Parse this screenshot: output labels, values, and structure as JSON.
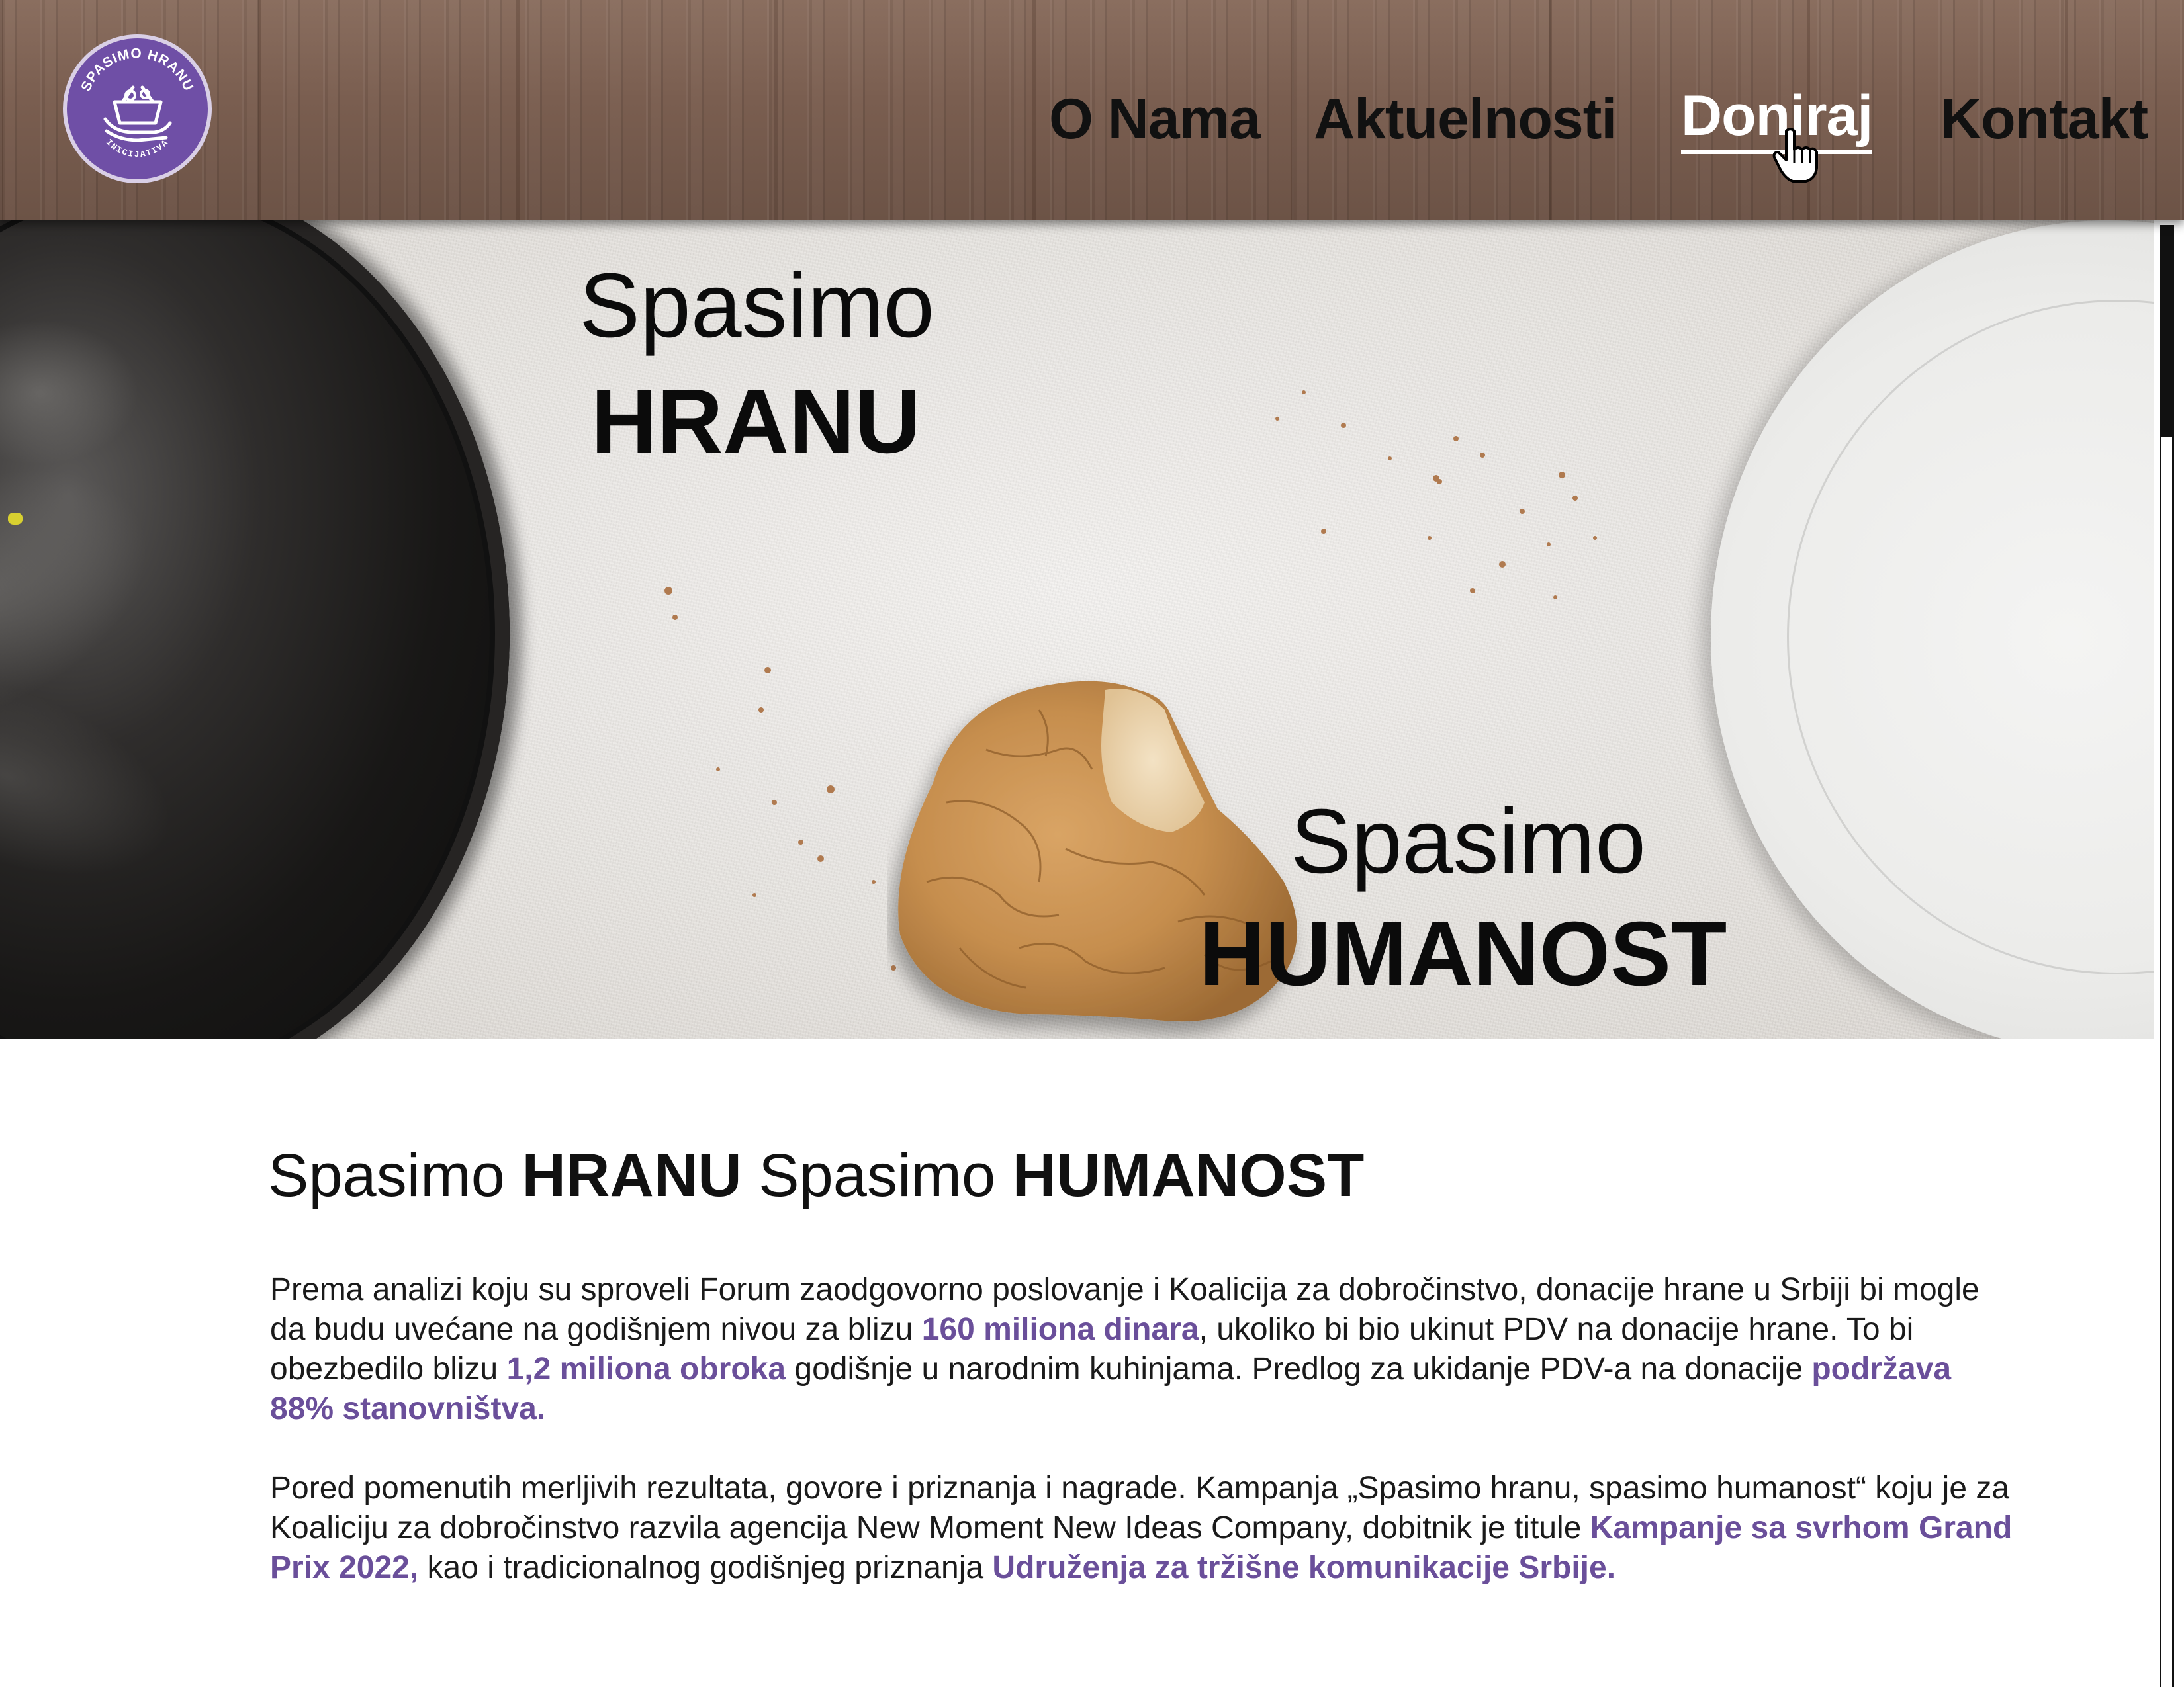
{
  "brand": {
    "logo_top_text": "SPASIMO HRANU",
    "logo_bottom_text": "INICIJATIVA",
    "accent_color": "#6f4fa6"
  },
  "nav": {
    "items": [
      {
        "label": "O Nama"
      },
      {
        "label": "Aktuelnosti"
      },
      {
        "label": "Doniraj",
        "active": true
      },
      {
        "label": "Kontakt"
      }
    ]
  },
  "hero": {
    "line1_light": "Spasimo",
    "line1_bold": "HRANU",
    "line2_light": "Spasimo",
    "line2_bold": "HUMANOST"
  },
  "content": {
    "title": {
      "part1": "Spasimo ",
      "part2": "HRANU",
      "part3": " Spasimo ",
      "part4": "HUMANOST"
    },
    "paragraph1": {
      "t1": "Prema analizi koju su sproveli Forum zaodgovorno poslovanje i Koalicija za dobročinstvo, donacije hrane u Srbiji bi mogle da budu uvećane na godišnjem nivou za blizu ",
      "h1": "160 miliona dinara",
      "t2": ", ukoliko bi bio ukinut PDV na donacije hrane.  To bi obezbedilo blizu ",
      "h2": "1,2 miliona obroka",
      "t3": " godišnje u narodnim kuhinjama. Predlog za ukidanje PDV-a na donacije ",
      "h3": "podržava 88% stanovništva."
    },
    "paragraph2": {
      "t1": "Pored pomenutih merljivih rezultata, govore i priznanja i nagrade. Kampanja „Spasimo hranu, spasimo humanost“ koju je za Koaliciju za dobročinstvo razvila agencija New Moment New Ideas Company, dobitnik je titule ",
      "h1": "Kampanje sa svrhom Grand Prix 2022,",
      "t2": " kao i tradicionalnog godišnjeg priznanja ",
      "h2": "Udruženja za tržišne komunikacije Srbije."
    },
    "highlight_color": "#6a4f9a"
  }
}
